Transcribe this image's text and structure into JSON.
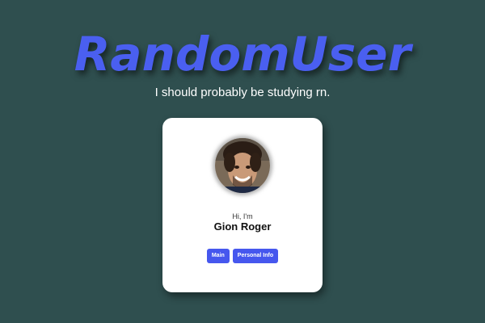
{
  "header": {
    "title": "RandomUser",
    "tagline": "I should probably be studying rn."
  },
  "profile": {
    "greeting": "Hi, I'm",
    "name": "Gion Roger",
    "avatar_alt": "Profile photo"
  },
  "actions": {
    "main_label": "Main",
    "personal_info_label": "Personal Info"
  },
  "colors": {
    "background": "#2f4f4f",
    "accent": "#4a5ff0",
    "button": "#4657ee",
    "card": "#ffffff"
  }
}
